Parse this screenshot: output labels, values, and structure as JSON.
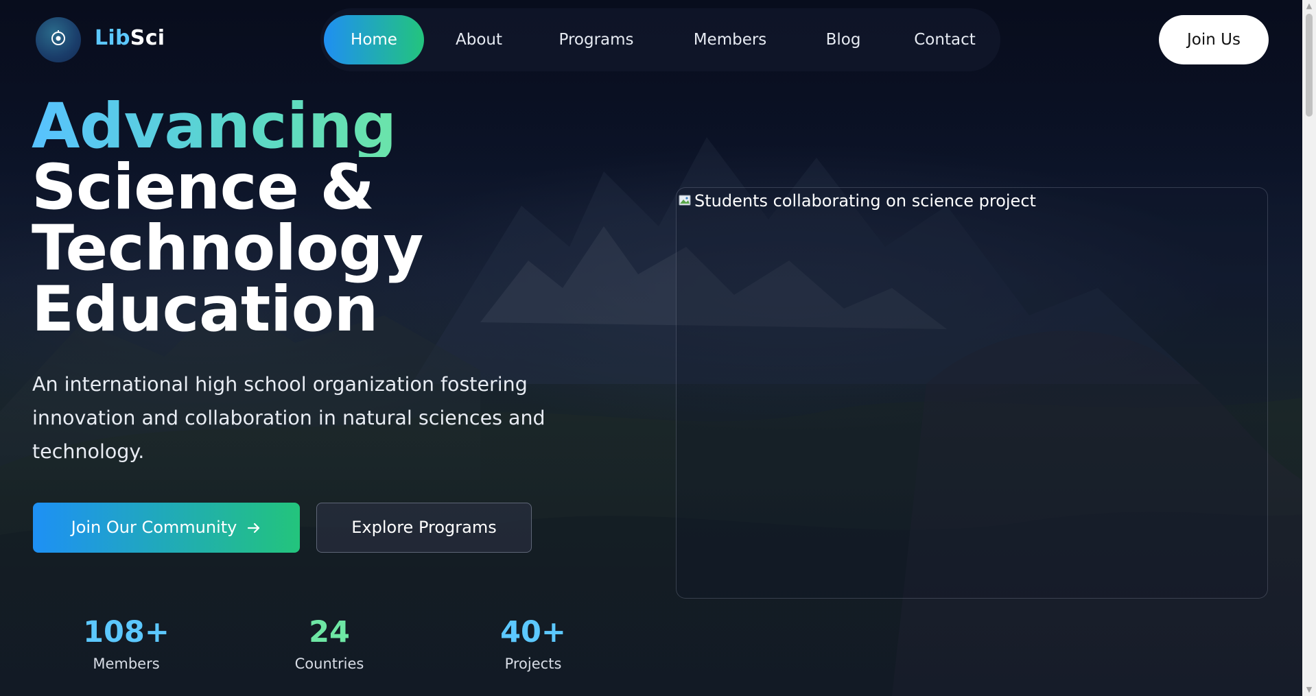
{
  "brand": {
    "prefix": "Lib",
    "suffix": "Sci"
  },
  "nav": {
    "items": [
      {
        "label": "Home",
        "active": true
      },
      {
        "label": "About",
        "active": false
      },
      {
        "label": "Programs",
        "active": false
      },
      {
        "label": "Members",
        "active": false
      },
      {
        "label": "Blog",
        "active": false
      },
      {
        "label": "Contact",
        "active": false
      }
    ],
    "cta_label": "Join Us"
  },
  "hero": {
    "title_accent": "Advancing",
    "title_lines": [
      "Science &",
      "Technology",
      "Education"
    ],
    "subtitle": "An international high school organization fostering innovation and collaboration in natural sciences and technology.",
    "primary_cta": "Join Our Community",
    "secondary_cta": "Explore Programs",
    "image_alt": "Students collaborating on science project"
  },
  "stats": [
    {
      "value": "108+",
      "label": "Members",
      "color": "#5cc8ff"
    },
    {
      "value": "24",
      "label": "Countries",
      "color": "#6ee6a4"
    },
    {
      "value": "40+",
      "label": "Projects",
      "color": "#5cc8ff"
    }
  ],
  "icons": {
    "logo": "circle-target-icon",
    "arrow": "arrow-right-icon",
    "broken_image": "broken-image-icon"
  },
  "colors": {
    "accent_blue": "#1f8ff2",
    "accent_green": "#23c47d",
    "background": "#0b1224"
  }
}
